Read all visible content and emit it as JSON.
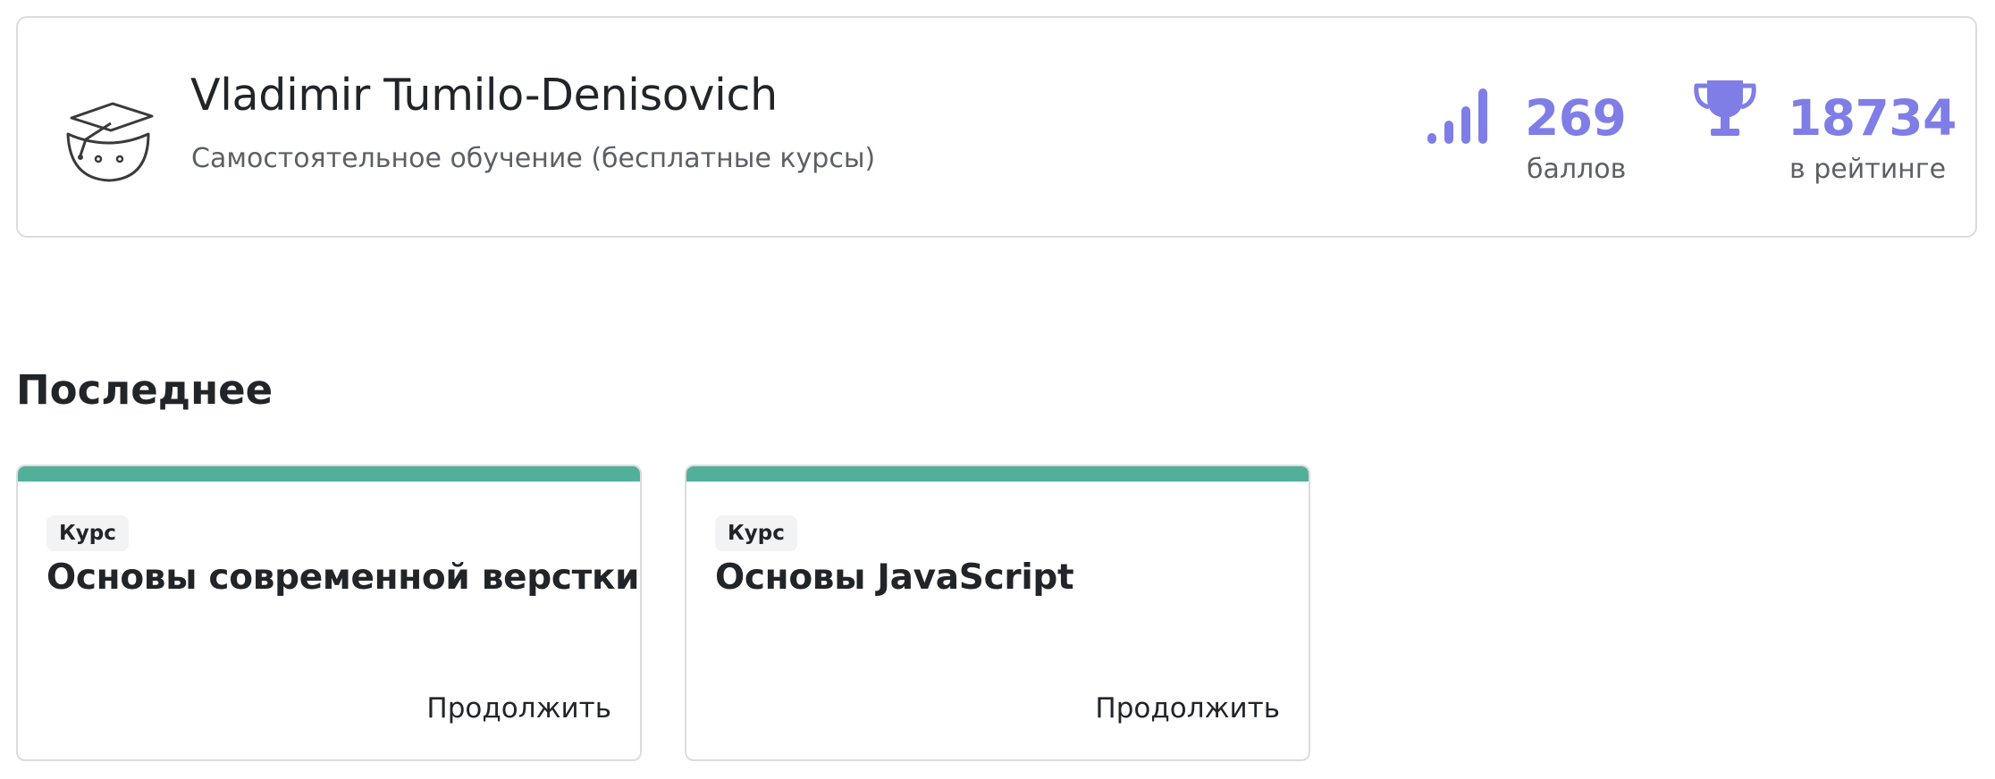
{
  "profile": {
    "name": "Vladimir Tumilo-Denisovich",
    "subtitle": "Самостоятельное обучение (бесплатные курсы)",
    "avatar_icon": "graduation-cap-smiley-icon"
  },
  "stats": {
    "points": {
      "value": "269",
      "label": "баллов",
      "icon": "signal-bars-icon"
    },
    "rating": {
      "value": "18734",
      "label": "в рейтинге",
      "icon": "trophy-icon"
    }
  },
  "recent": {
    "title": "Последнее",
    "courses": [
      {
        "badge": "Курс",
        "title": "Основы современной верстки",
        "action": "Продолжить"
      },
      {
        "badge": "Курс",
        "title": "Основы JavaScript",
        "action": "Продолжить"
      }
    ]
  },
  "colors": {
    "accent": "#7f7ee6",
    "card_top_bar": "#52b09a",
    "border": "#dcdcde",
    "muted_text": "#5c5f66"
  }
}
